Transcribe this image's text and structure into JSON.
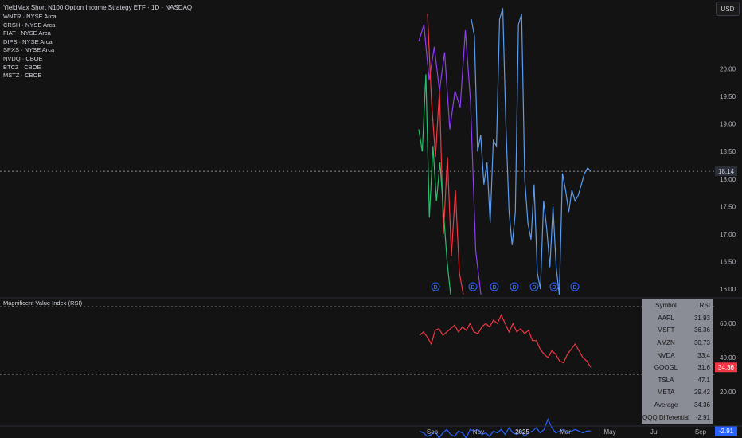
{
  "header": {
    "title": "YieldMax Short N100 Option Income Strategy ETF · 1D · NASDAQ",
    "symbols": [
      "WNTR · NYSE Arca",
      "CRSH · NYSE Arca",
      "FIAT · NYSE Arca",
      "DIPS · NYSE Arca",
      "SPXS · NYSE Arca",
      "NVDQ · CBOE",
      "BTCZ · CBOE",
      "MSTZ · CBOE"
    ],
    "currency": "USD"
  },
  "indicator": {
    "title": "Magnificent Value Index (RSI)",
    "table_header": [
      "Symbol",
      "RSI"
    ],
    "table_rows": [
      [
        "AAPL",
        "31.93"
      ],
      [
        "MSFT",
        "36.36"
      ],
      [
        "AMZN",
        "30.73"
      ],
      [
        "NVDA",
        "33.4"
      ],
      [
        "GOOGL",
        "31.6"
      ],
      [
        "TSLA",
        "47.1"
      ],
      [
        "META",
        "29.42"
      ],
      [
        "Average",
        "34.36"
      ],
      [
        "QQQ Differential",
        "-2.91"
      ]
    ]
  },
  "colors": {
    "background": "#131313",
    "blue_series": "#5b9cf0",
    "purple_series": "#8e3ff2",
    "red_series": "#f23645",
    "green_series": "#26c26b",
    "rsi_red": "#f23645",
    "rsi_blue": "#2962ff",
    "table_bg": "#8a8d96"
  },
  "chart_data": [
    {
      "type": "line",
      "x_ticks": [
        "Sep",
        "Nov",
        "2025",
        "Mar",
        "May",
        "Jul",
        "Sep"
      ],
      "y_ticks": [
        16.0,
        16.5,
        17.0,
        17.5,
        18.0,
        18.5,
        19.0,
        19.5,
        20.0
      ],
      "ylim": [
        15.9,
        21.25
      ],
      "current_price": 18.14,
      "dividend_markers": [
        "D",
        "D",
        "D",
        "D",
        "D",
        "D",
        "D"
      ],
      "series": [
        {
          "values": [
            20.9,
            20.6,
            18.5,
            18.8,
            17.9,
            18.3,
            17.2,
            18.7,
            18.6,
            20.9,
            21.1,
            19.0,
            17.4,
            16.8,
            17.4,
            20.8,
            21.0,
            18.0,
            17.2,
            16.9,
            17.9,
            16.3,
            16.0,
            17.6,
            17.1,
            16.4,
            17.5,
            16.4,
            15.9,
            18.1,
            17.8,
            17.4,
            17.8,
            17.6,
            17.7,
            17.9,
            18.1,
            18.2,
            18.14
          ]
        },
        {
          "values": [
            20.5,
            20.8,
            19.8,
            20.4,
            19.6,
            20.3,
            18.9,
            19.6,
            19.3,
            20.7,
            19.4,
            16.7,
            15.9
          ]
        },
        {
          "values": [
            21.0,
            19.4,
            18.4,
            19.6,
            17.0,
            18.4,
            16.6,
            17.8,
            16.3,
            15.9
          ]
        },
        {
          "values": [
            18.9,
            18.5,
            19.9,
            17.3,
            18.6,
            17.6,
            18.3,
            17.4,
            16.5,
            15.9
          ]
        }
      ]
    },
    {
      "type": "line",
      "y_ticks": [
        20.0,
        40.0,
        60.0
      ],
      "ylim": [
        0,
        75
      ],
      "series": [
        {
          "values": [
            53,
            55,
            52,
            48,
            56,
            57,
            53,
            55,
            57,
            59,
            55,
            58,
            56,
            60,
            55,
            54,
            58,
            60,
            58,
            62,
            60,
            65,
            60,
            55,
            60,
            55,
            57,
            54,
            56,
            50,
            50,
            45,
            42,
            40,
            44,
            42,
            38,
            37,
            42,
            45,
            48,
            44,
            40,
            38,
            34.36
          ]
        },
        {
          "values": [
            -3,
            -4,
            -6,
            -5,
            -3,
            -7,
            -4,
            -2,
            -5,
            -6,
            -3,
            -4,
            -7,
            -2,
            -3,
            -2,
            -5,
            -4,
            -6,
            -3,
            -4,
            -2,
            -5,
            -1,
            -4,
            -5,
            -3,
            -6,
            -4,
            -3,
            -1,
            -4,
            -2,
            4,
            -1,
            -4,
            -3,
            -2,
            -4,
            -3,
            -2,
            -3,
            -4,
            -3,
            -2.91
          ]
        }
      ],
      "current_values": [
        "34.36",
        "-2.91"
      ]
    }
  ]
}
